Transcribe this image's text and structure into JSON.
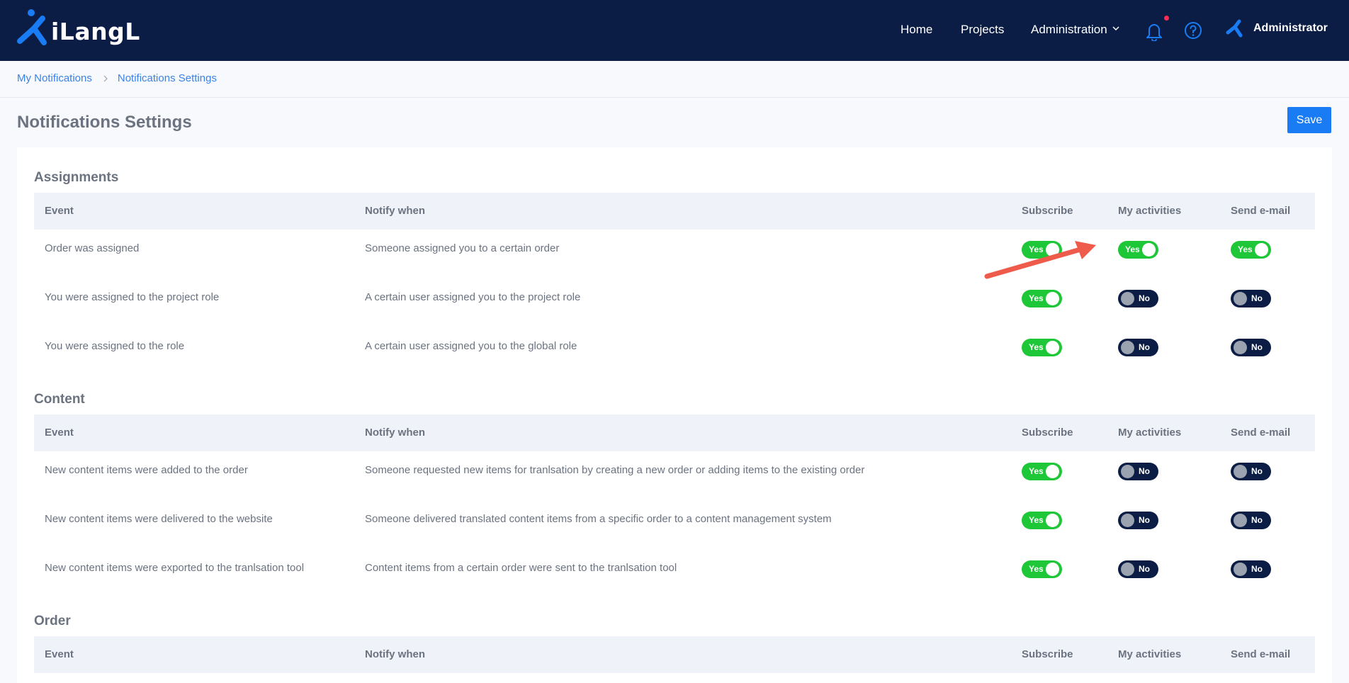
{
  "header": {
    "logo_text": "iLangL",
    "nav": {
      "home": "Home",
      "projects": "Projects",
      "administration": "Administration"
    },
    "user_name": "Administrator",
    "accent_color": "#1a7cf4",
    "background_color": "#0b1d44",
    "notification_dot_color": "#ff2b50"
  },
  "breadcrumb": {
    "items": [
      "My Notifications",
      "Notifications Settings"
    ]
  },
  "page": {
    "title": "Notifications Settings",
    "save_label": "Save"
  },
  "columns": {
    "event": "Event",
    "notify": "Notify when",
    "subscribe": "Subscribe",
    "activities": "My activities",
    "email": "Send e-mail"
  },
  "toggle_labels": {
    "on": "Yes",
    "off": "No"
  },
  "toggle_colors": {
    "on": "#1ec737",
    "off": "#0b1d44"
  },
  "sections": [
    {
      "title": "Assignments",
      "rows": [
        {
          "event": "Order was assigned",
          "notify": "Someone assigned you to a certain order",
          "subscribe": true,
          "activities": true,
          "email": true
        },
        {
          "event": "You were assigned to the project role",
          "notify": "A certain user assigned you to the project role",
          "subscribe": true,
          "activities": false,
          "email": false
        },
        {
          "event": "You were assigned to the role",
          "notify": "A certain user assigned you to the global role",
          "subscribe": true,
          "activities": false,
          "email": false
        }
      ]
    },
    {
      "title": "Content",
      "rows": [
        {
          "event": "New content items were added to the order",
          "notify": "Someone requested new items for tranlsation by creating a new order or adding items to the existing order",
          "subscribe": true,
          "activities": false,
          "email": false
        },
        {
          "event": "New content items were delivered to the website",
          "notify": "Someone delivered translated content items from a specific order to a content management system",
          "subscribe": true,
          "activities": false,
          "email": false
        },
        {
          "event": "New content items were exported to the tranlsation tool",
          "notify": "Content items from a certain order were sent to the tranlsation tool",
          "subscribe": true,
          "activities": false,
          "email": false
        }
      ]
    },
    {
      "title": "Order",
      "rows": []
    }
  ],
  "annotation": {
    "arrow_color": "#ef5b4b"
  }
}
